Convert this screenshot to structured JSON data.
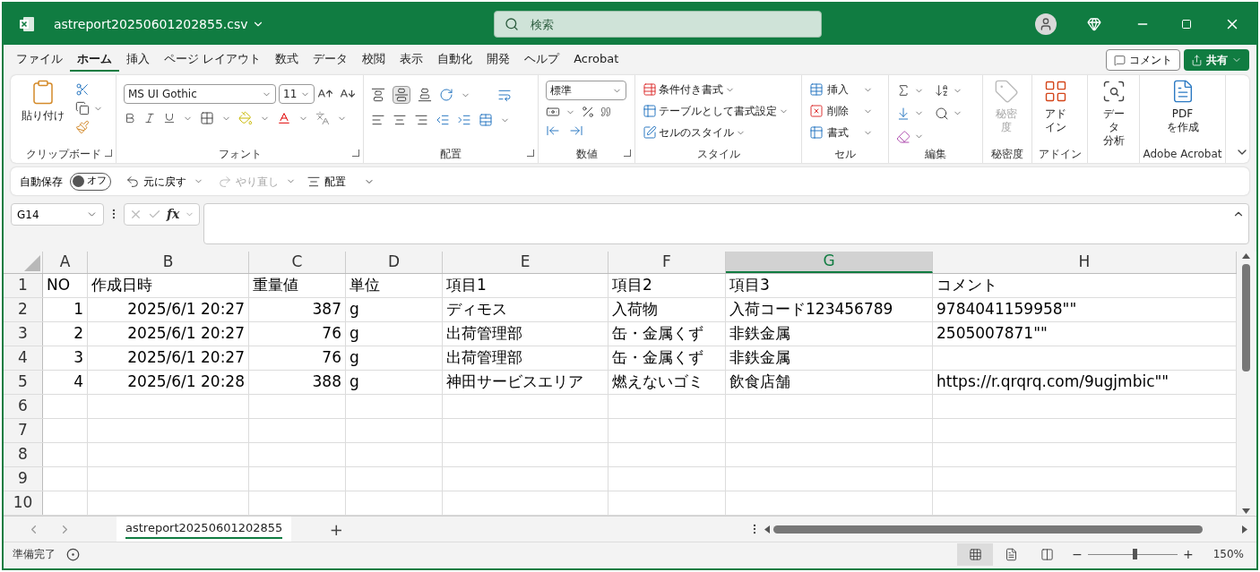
{
  "window": {
    "title": "astreport20250601202855.csv",
    "search_placeholder": "検索"
  },
  "menu_tabs": [
    {
      "label": "ファイル",
      "selected": false
    },
    {
      "label": "ホーム",
      "selected": true
    },
    {
      "label": "挿入",
      "selected": false
    },
    {
      "label": "ページ レイアウト",
      "selected": false
    },
    {
      "label": "数式",
      "selected": false
    },
    {
      "label": "データ",
      "selected": false
    },
    {
      "label": "校閲",
      "selected": false
    },
    {
      "label": "表示",
      "selected": false
    },
    {
      "label": "自動化",
      "selected": false
    },
    {
      "label": "開発",
      "selected": false
    },
    {
      "label": "ヘルプ",
      "selected": false
    },
    {
      "label": "Acrobat",
      "selected": false
    }
  ],
  "comment_button": "コメント",
  "share_button": "共有",
  "ribbon": {
    "clipboard": {
      "paste": "貼り付け",
      "label": "クリップボード"
    },
    "font": {
      "font_name": "MS UI Gothic",
      "font_size": "11",
      "label": "フォント"
    },
    "alignment": {
      "label": "配置"
    },
    "number": {
      "format": "標準",
      "label": "数値"
    },
    "styles": {
      "items": [
        "条件付き書式",
        "テーブルとして書式設定",
        "セルのスタイル"
      ],
      "label": "スタイル"
    },
    "cells": {
      "items": [
        "挿入",
        "削除",
        "書式"
      ],
      "label": "セル"
    },
    "editing": {
      "label": "編集"
    },
    "sensitivity": {
      "lines": [
        "秘密",
        "度"
      ],
      "label": "秘密度",
      "disabled": true
    },
    "addins": {
      "lines": [
        "アド",
        "イン"
      ],
      "label": "アドイン"
    },
    "analysis": {
      "lines": [
        "データ",
        "分析"
      ]
    },
    "acrobat": {
      "lines": [
        "PDF",
        "を作成"
      ],
      "label": "Adobe Acrobat"
    }
  },
  "quick_access": {
    "autosave_label": "自動保存",
    "autosave_state": "オフ",
    "autosave_on": false,
    "undo": "元に戻す",
    "redo": "やり直し",
    "redo_disabled": true,
    "align": "配置"
  },
  "formula_bar": {
    "name_box": "G14",
    "function_label": "fx"
  },
  "sheet": {
    "columns": [
      {
        "label": "A",
        "selected": false
      },
      {
        "label": "B",
        "selected": false
      },
      {
        "label": "C",
        "selected": false
      },
      {
        "label": "D",
        "selected": false
      },
      {
        "label": "E",
        "selected": false
      },
      {
        "label": "F",
        "selected": false
      },
      {
        "label": "G",
        "selected": true
      },
      {
        "label": "H",
        "selected": false
      }
    ],
    "rows": [
      {
        "header": "1",
        "cells": {
          "A": "NO",
          "B": "作成日時",
          "C": "重量値",
          "D": "単位",
          "E": "項目1",
          "F": "項目2",
          "G": "項目3",
          "H": "コメント"
        }
      },
      {
        "header": "2",
        "cells": {
          "A": "1",
          "B": "2025/6/1 20:27",
          "C": "387",
          "D": "g",
          "E": "ディモス",
          "F": "入荷物",
          "G": "入荷コード123456789",
          "H": "9784041159958\"\""
        }
      },
      {
        "header": "3",
        "cells": {
          "A": "2",
          "B": "2025/6/1 20:27",
          "C": "76",
          "D": "g",
          "E": "出荷管理部",
          "F": "缶・金属くず",
          "G": "非鉄金属",
          "H": "2505007871\"\""
        }
      },
      {
        "header": "4",
        "cells": {
          "A": "3",
          "B": "2025/6/1 20:27",
          "C": "76",
          "D": "g",
          "E": "出荷管理部",
          "F": "缶・金属くず",
          "G": "非鉄金属"
        }
      },
      {
        "header": "5",
        "cells": {
          "A": "4",
          "B": "2025/6/1 20:28",
          "C": "388",
          "D": "g",
          "E": "神田サービスエリア",
          "F": "燃えないゴミ",
          "G": "飲食店舗",
          "H": "https://r.qrqrq.com/9ugjmbic\"\""
        }
      },
      {
        "header": "6",
        "cells": {}
      },
      {
        "header": "7",
        "cells": {}
      },
      {
        "header": "8",
        "cells": {}
      },
      {
        "header": "9",
        "cells": {}
      },
      {
        "header": "10",
        "cells": {}
      }
    ]
  },
  "sheet_tabs": [
    {
      "label": "astreport20250601202855",
      "selected": true
    }
  ],
  "add_sheet": "+",
  "status_bar": {
    "status": "準備完了",
    "views": [
      {
        "kind": "normal",
        "selected": true
      },
      {
        "kind": "page_layout",
        "selected": false
      },
      {
        "kind": "page_break",
        "selected": false
      }
    ],
    "zoom_minus": "−",
    "zoom_plus": "+",
    "zoom": {
      "level": 0.52
    },
    "zoom_label": "150%"
  }
}
